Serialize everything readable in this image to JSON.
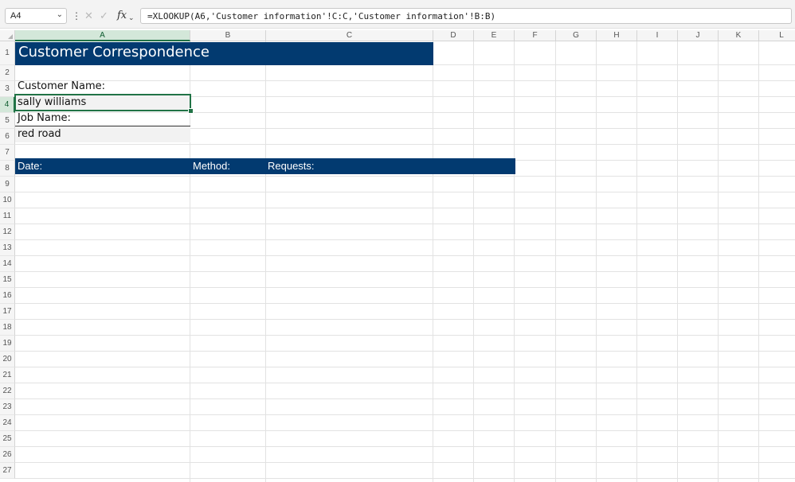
{
  "formula_bar": {
    "name_box": "A4",
    "formula": "=XLOOKUP(A6,'Customer information'!C:C,'Customer information'!B:B)",
    "icons": [
      "chevron-down-icon",
      "more-icon",
      "cancel-icon",
      "enter-icon",
      "fx-icon",
      "chevron-down-icon"
    ]
  },
  "grid": {
    "columns": [
      "A",
      "B",
      "C",
      "D",
      "E",
      "F",
      "G",
      "H",
      "I",
      "J",
      "K",
      "L"
    ],
    "rows": [
      "1",
      "2",
      "3",
      "4",
      "5",
      "6",
      "7",
      "8",
      "9",
      "10",
      "11",
      "12",
      "13",
      "14",
      "15",
      "16",
      "17",
      "18",
      "19",
      "20",
      "21",
      "22",
      "23",
      "24",
      "25",
      "26",
      "27"
    ],
    "active_cell": "A4"
  },
  "sheet": {
    "title": "Customer Correspondence",
    "customer_name_label": "Customer Name:",
    "customer_name_value": "sally williams",
    "job_name_label": "Job Name:",
    "job_name_value": "red road",
    "table_header": {
      "date": "Date:",
      "method": "Method:",
      "requests": "Requests:"
    }
  },
  "colors": {
    "header_fill": "#023a70",
    "selection": "#217346"
  }
}
